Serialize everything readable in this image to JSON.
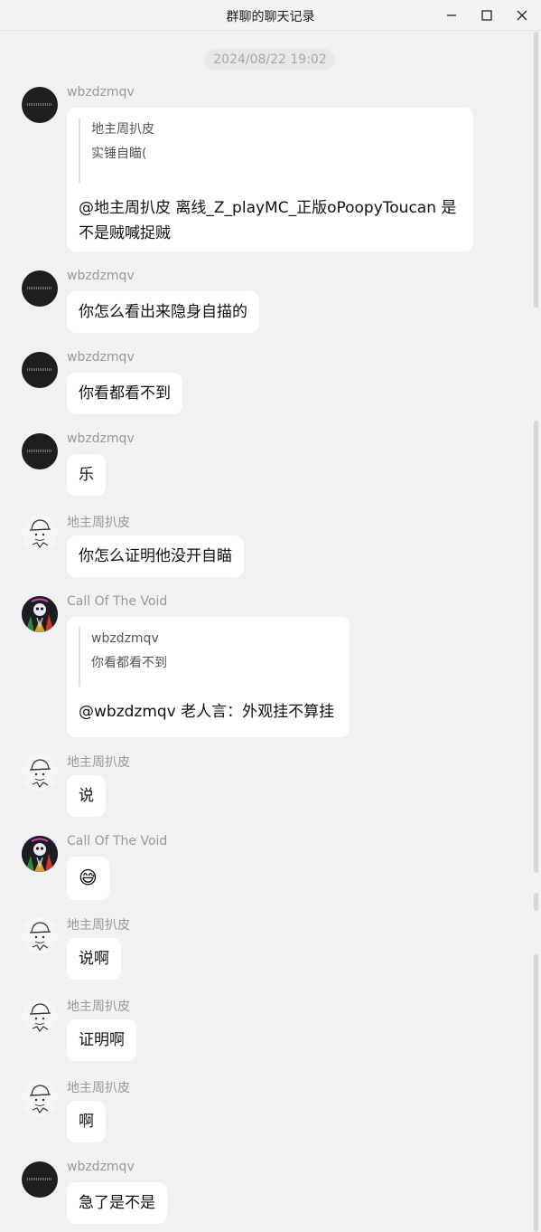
{
  "window": {
    "title": "群聊的聊天记录"
  },
  "date_separator": "2024/08/22 19:02",
  "messages": [
    {
      "sender": "wbzdzmqv",
      "avatar": "black-avatar",
      "quote_author": "地主周扒皮",
      "quote_text": "实锤自瞄(",
      "line1": "@地主周扒皮 离线_Z_playMC_正版oPoopyToucan 是",
      "line2": "不是贼喊捉贼"
    },
    {
      "sender": "wbzdzmqv",
      "avatar": "black-avatar",
      "text": "你怎么看出来隐身自描的"
    },
    {
      "sender": "wbzdzmqv",
      "avatar": "black-avatar",
      "text": "你看都看不到"
    },
    {
      "sender": "wbzdzmqv",
      "avatar": "black-avatar",
      "text": "乐"
    },
    {
      "sender": "地主周扒皮",
      "avatar": "sketch-avatar",
      "text": "你怎么证明他没开自瞄"
    },
    {
      "sender": "Call Of The Void",
      "avatar": "skull-avatar",
      "quote_author": "wbzdzmqv",
      "quote_text": "你看都看不到",
      "text": "@wbzdzmqv 老人言：外观挂不算挂"
    },
    {
      "sender": "地主周扒皮",
      "avatar": "sketch-avatar",
      "text": "说"
    },
    {
      "sender": "Call Of The Void",
      "avatar": "skull-avatar",
      "text": "😅"
    },
    {
      "sender": "地主周扒皮",
      "avatar": "sketch-avatar",
      "text": "说啊"
    },
    {
      "sender": "地主周扒皮",
      "avatar": "sketch-avatar",
      "text": "证明啊"
    },
    {
      "sender": "地主周扒皮",
      "avatar": "sketch-avatar",
      "text": "啊"
    },
    {
      "sender": "wbzdzmqv",
      "avatar": "black-avatar",
      "text": "急了是不是"
    }
  ]
}
